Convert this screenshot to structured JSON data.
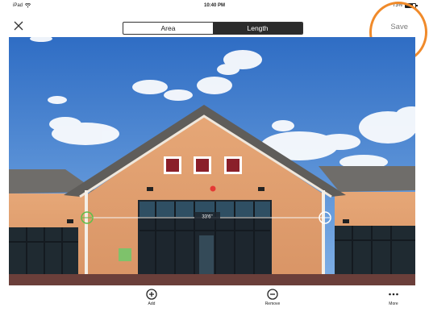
{
  "status": {
    "device": "iPad",
    "time": "10:40 PM",
    "battery": "73%",
    "battery_level": 0.73
  },
  "toolbar": {
    "tabs": [
      {
        "label": "Area",
        "active": false
      },
      {
        "label": "Length",
        "active": true
      }
    ],
    "save_label": "Save"
  },
  "measurement": {
    "length_label": "33'6\""
  },
  "bottom": {
    "add_label": "Add",
    "remove_label": "Remove",
    "more_label": "More"
  },
  "colors": {
    "highlight_ring": "#f08a2a",
    "segment_active": "#2b2b2b",
    "start_marker": "#5fbf4a",
    "end_marker": "#ffffff",
    "center_dot": "#e53935"
  },
  "icons": [
    "wifi-icon",
    "battery-icon",
    "close-icon",
    "plus-circle-icon",
    "minus-circle-icon",
    "more-dots-icon"
  ]
}
